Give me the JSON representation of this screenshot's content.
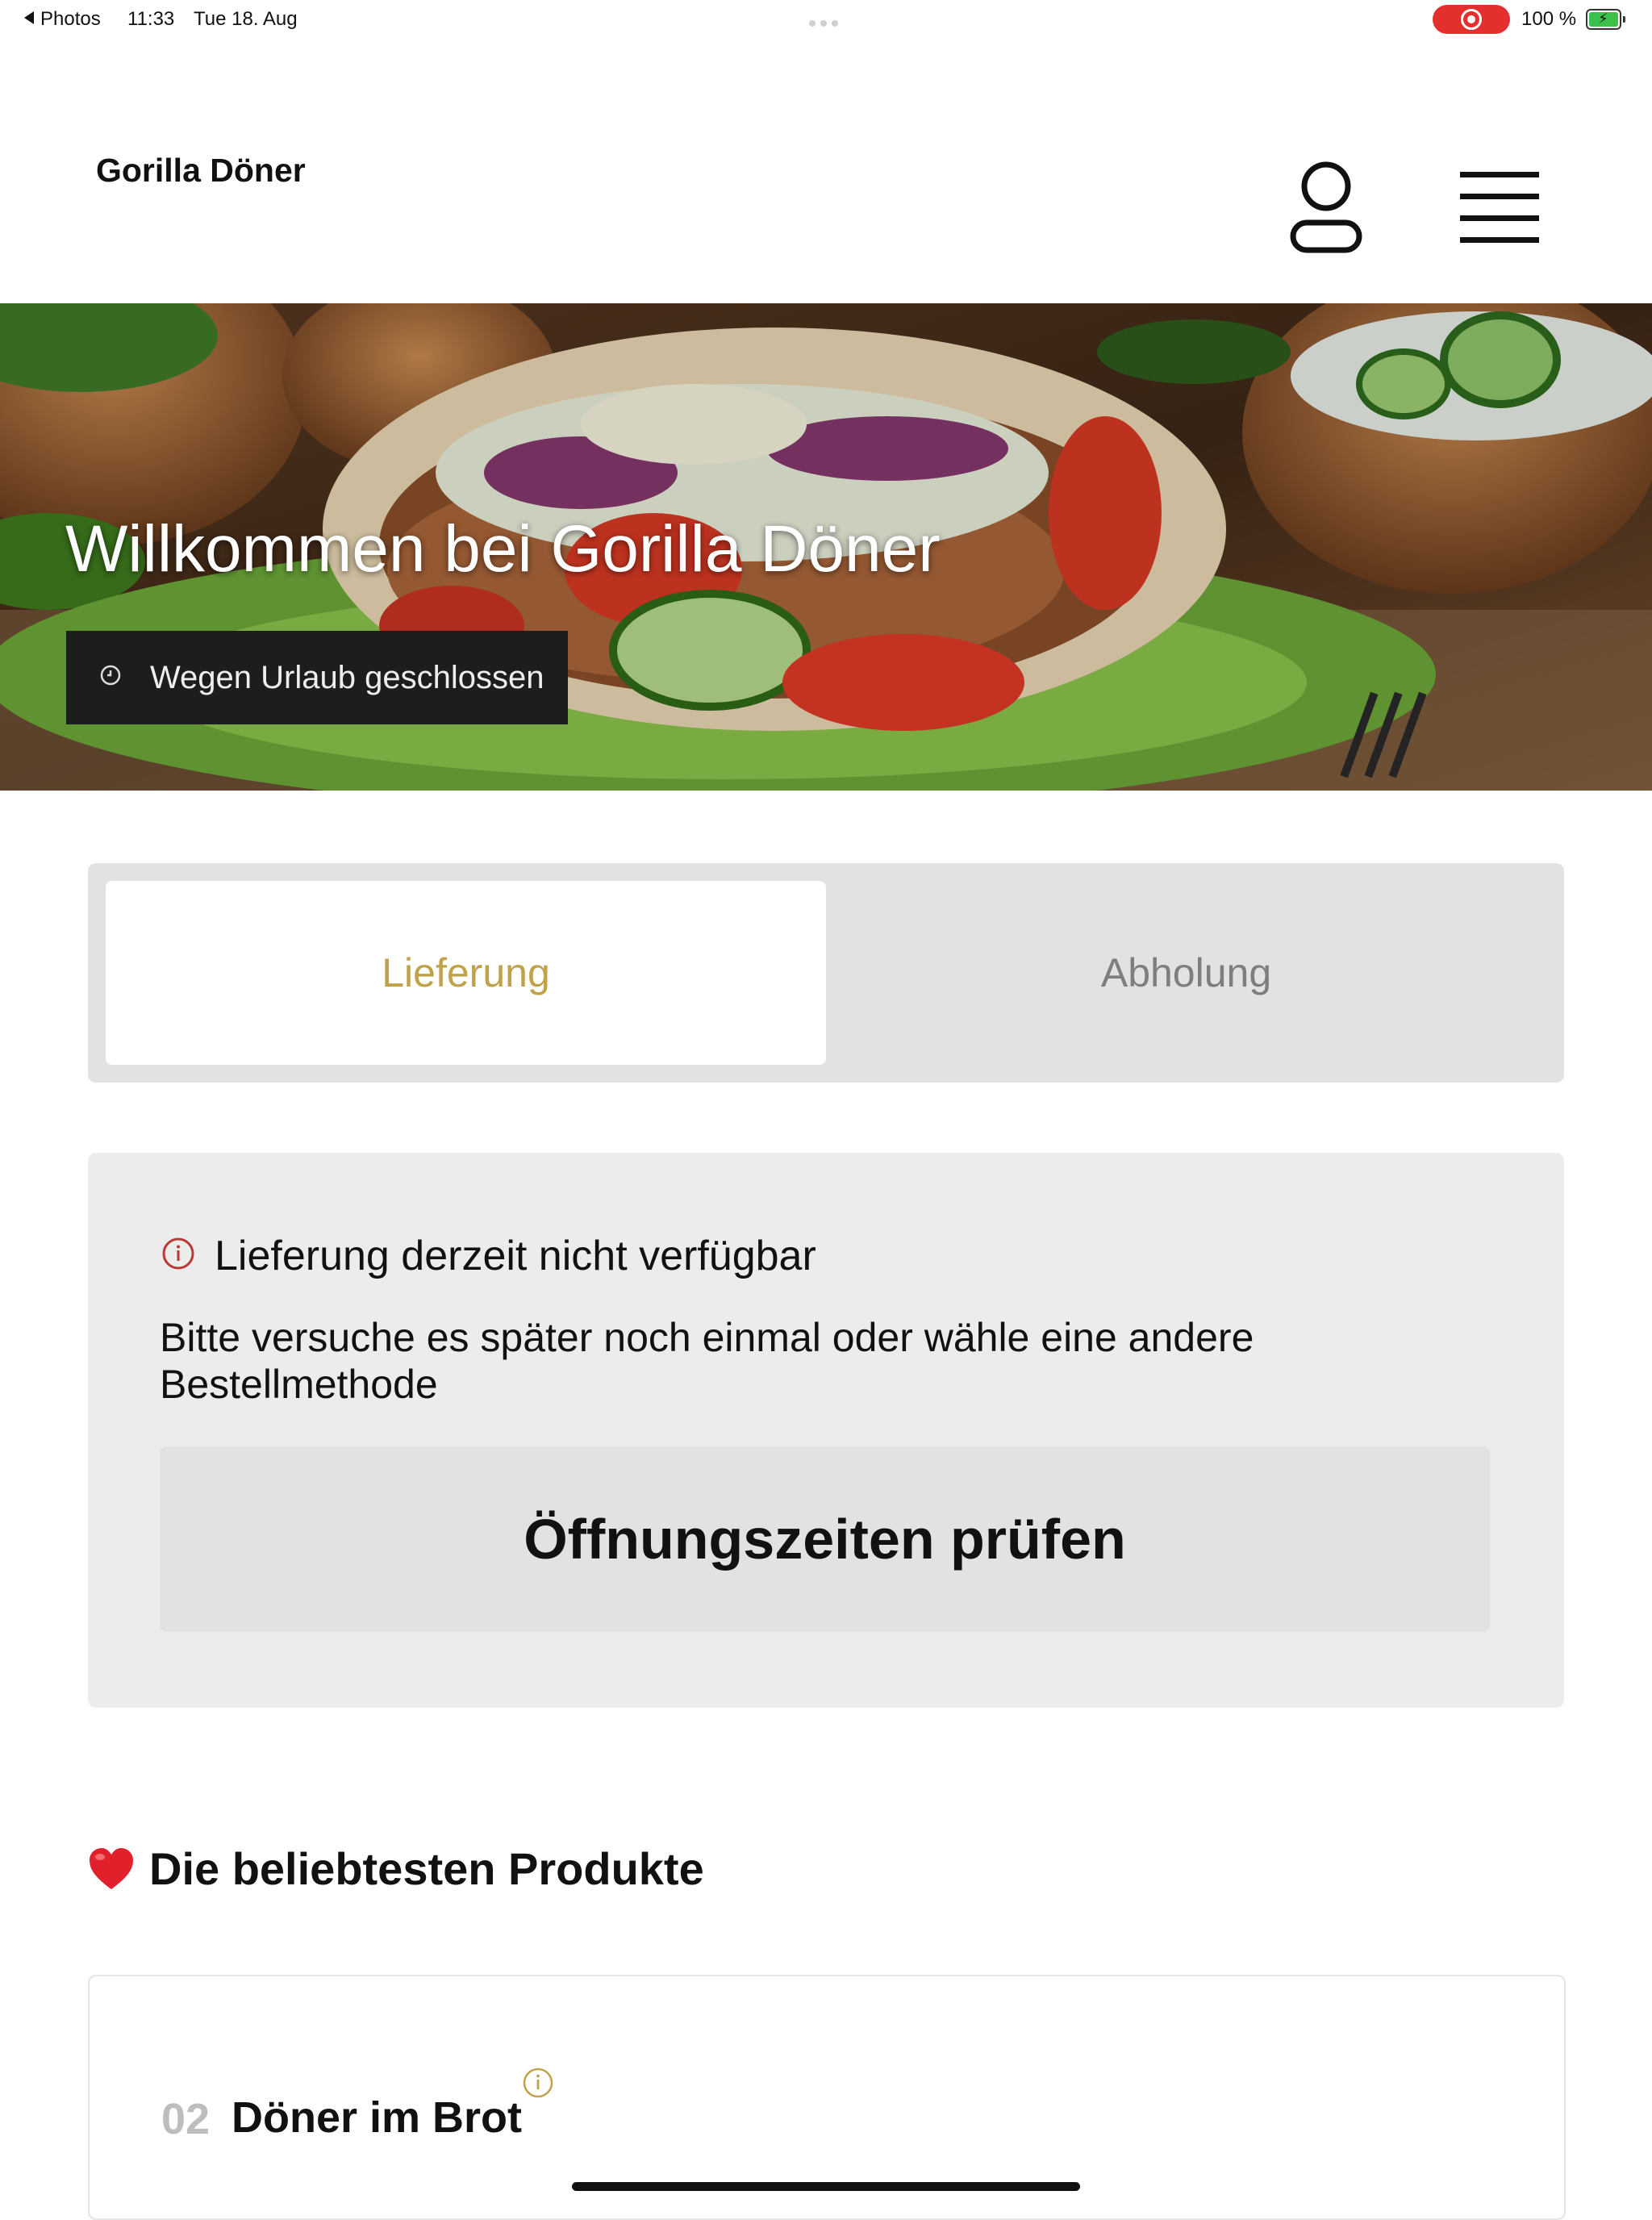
{
  "status_bar": {
    "back_app": "Photos",
    "time": "11:33",
    "date": "Tue 18. Aug",
    "battery": "100 %"
  },
  "header": {
    "brand": "Gorilla Döner",
    "icons": {
      "account": "user-icon",
      "menu": "hamburger-menu-icon"
    }
  },
  "hero": {
    "title": "Willkommen bei Gorilla Döner",
    "status_badge": "Wegen Urlaub geschlossen",
    "badge_icon": "clock-icon"
  },
  "order_method": {
    "options": [
      "Lieferung",
      "Abholung"
    ],
    "selected": "Lieferung"
  },
  "notice": {
    "icon": "info-icon",
    "title": "Lieferung derzeit nicht verfügbar",
    "message": "Bitte versuche es später noch einmal oder wähle eine andere Bestellmethode",
    "button": "Öffnungszeiten prüfen"
  },
  "popular": {
    "title": "Die beliebtesten Produkte",
    "icon": "heart-icon",
    "products": [
      {
        "number": "02",
        "name": "Döner im Brot"
      }
    ]
  },
  "colors": {
    "accent": "#bfa24a",
    "alert": "#b83a36",
    "badge_bg": "#1d1d1d",
    "panel_bg": "#ececec"
  }
}
